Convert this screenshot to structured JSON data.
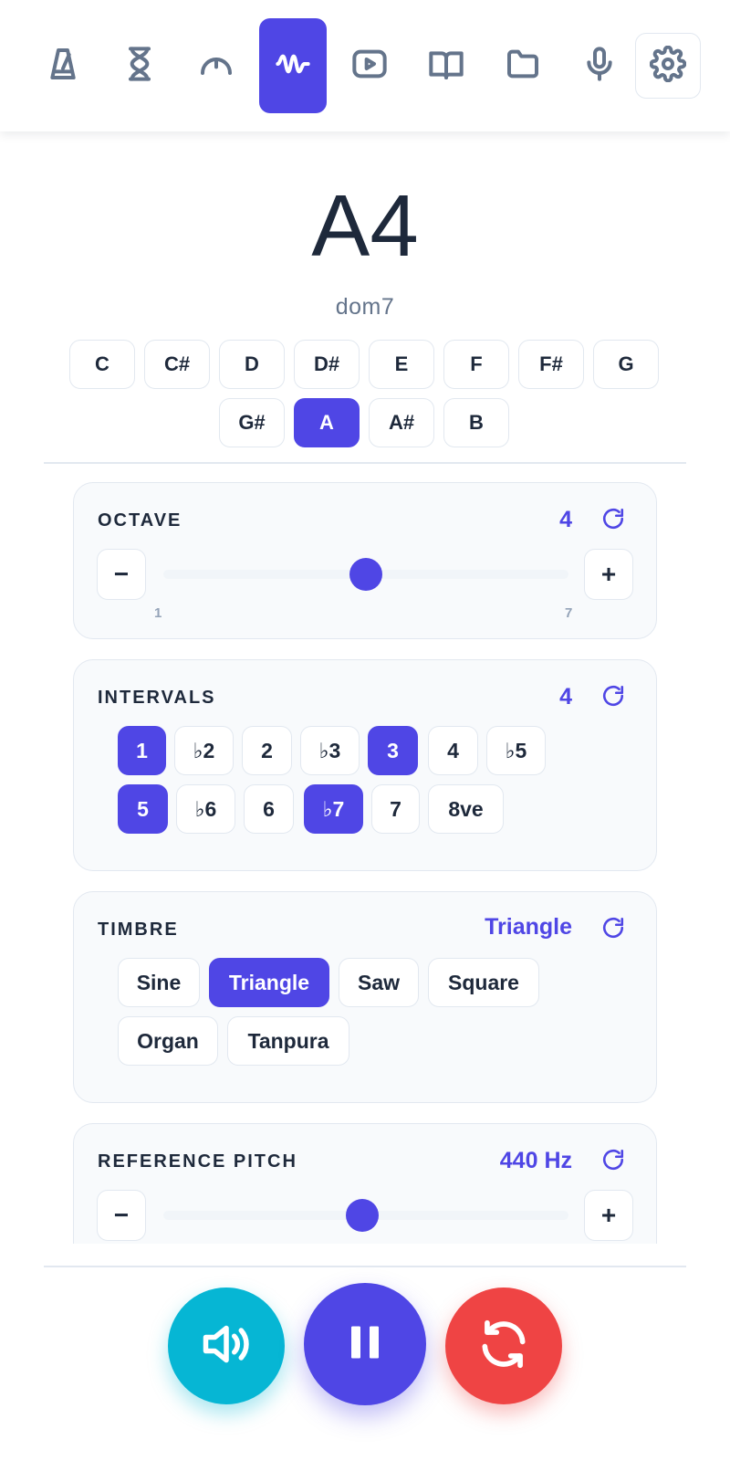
{
  "nav": {
    "items": [
      {
        "icon": "metronome-icon",
        "label": "metronome"
      },
      {
        "icon": "hourglass-icon",
        "label": "timer"
      },
      {
        "icon": "tuner-gauge-icon",
        "label": "tuner"
      },
      {
        "icon": "waveform-icon",
        "label": "drone",
        "active": true
      },
      {
        "icon": "video-icon",
        "label": "video"
      },
      {
        "icon": "book-icon",
        "label": "book"
      },
      {
        "icon": "folder-icon",
        "label": "folder"
      },
      {
        "icon": "microphone-icon",
        "label": "microphone"
      },
      {
        "icon": "gear-icon",
        "label": "settings"
      }
    ]
  },
  "header": {
    "note": "A4",
    "chord": "dom7"
  },
  "notes": {
    "row1": [
      "C",
      "C#",
      "D",
      "D#",
      "E",
      "F",
      "F#",
      "G"
    ],
    "row2": [
      "G#",
      "A",
      "A#",
      "B"
    ],
    "selected": "A"
  },
  "octave": {
    "title": "OCTAVE",
    "value": "4",
    "min_label": "1",
    "max_label": "7",
    "level": 4,
    "min": 1,
    "max": 7,
    "minus": "−",
    "plus": "+"
  },
  "intervals": {
    "title": "INTERVALS",
    "value": "4",
    "row1": [
      {
        "label": "1",
        "active": true
      },
      {
        "label": "♭2",
        "active": false
      },
      {
        "label": "2",
        "active": false
      },
      {
        "label": "♭3",
        "active": false
      },
      {
        "label": "3",
        "active": true
      },
      {
        "label": "4",
        "active": false
      },
      {
        "label": "♭5",
        "active": false
      }
    ],
    "row2": [
      {
        "label": "5",
        "active": true
      },
      {
        "label": "♭6",
        "active": false
      },
      {
        "label": "6",
        "active": false
      },
      {
        "label": "♭7",
        "active": true
      },
      {
        "label": "7",
        "active": false
      },
      {
        "label": "8ve",
        "active": false
      }
    ]
  },
  "timbre": {
    "title": "TIMBRE",
    "value": "Triangle",
    "options": [
      "Sine",
      "Triangle",
      "Saw",
      "Square",
      "Organ",
      "Tanpura"
    ],
    "selected": "Triangle"
  },
  "reference_pitch": {
    "title": "REFERENCE PITCH",
    "value": "440 Hz",
    "level_fraction": 0.49,
    "minus": "−",
    "plus": "+"
  },
  "controls": {
    "sound": "speaker-icon",
    "play_state": "pause-icon",
    "refresh": "refresh-icon"
  },
  "colors": {
    "accent": "#4f46e5",
    "cyan": "#06b6d4",
    "red": "#ef4444"
  }
}
